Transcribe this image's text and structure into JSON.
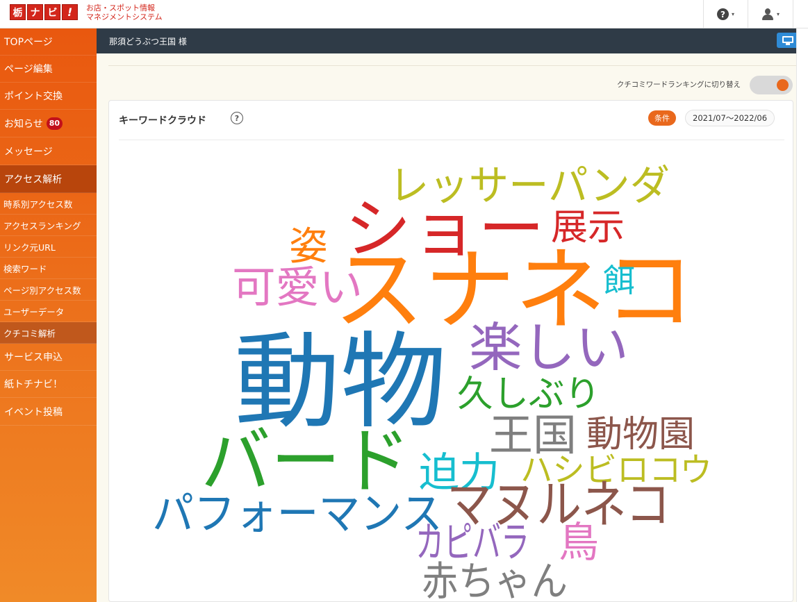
{
  "header": {
    "logo_chars": [
      "栃",
      "ナ",
      "ビ",
      "!"
    ],
    "logo_line1": "お店・スポット情報",
    "logo_line2": "マネジメントシステム",
    "help_caret": "▾",
    "user_caret": "▾"
  },
  "sidebar": {
    "items": [
      {
        "label": "TOPページ"
      },
      {
        "label": "ページ編集"
      },
      {
        "label": "ポイント交換"
      },
      {
        "label": "お知らせ",
        "badge": "80"
      },
      {
        "label": "メッセージ"
      },
      {
        "label": "アクセス解析"
      }
    ],
    "sub_items": [
      {
        "label": "時系別アクセス数"
      },
      {
        "label": "アクセスランキング"
      },
      {
        "label": "リンク元URL"
      },
      {
        "label": "検索ワード"
      },
      {
        "label": "ページ別アクセス数"
      },
      {
        "label": "ユーザーデータ"
      },
      {
        "label": "クチコミ解析"
      }
    ],
    "bottom_items": [
      {
        "label": "サービス申込"
      },
      {
        "label": "紙トチナビ！"
      },
      {
        "label": "イベント投稿"
      }
    ]
  },
  "subbar": {
    "account": "那須どうぶつ王国 様"
  },
  "toggle": {
    "label": "クチコミワードランキングに切り替え"
  },
  "card": {
    "title": "キーワードクラウド",
    "help": "?",
    "condition_label": "条件",
    "period": "2021/07〜2022/06"
  },
  "chart_data": {
    "type": "wordcloud",
    "words": [
      {
        "text": "レッサーパンダ",
        "color": "#bcbd22"
      },
      {
        "text": "ショー",
        "color": "#d62728"
      },
      {
        "text": "展示",
        "color": "#d62728"
      },
      {
        "text": "姿",
        "color": "#ff7f0e"
      },
      {
        "text": "可愛い",
        "color": "#e377c2"
      },
      {
        "text": "スナネコ",
        "color": "#ff7f0e"
      },
      {
        "text": "餌",
        "color": "#17becf"
      },
      {
        "text": "楽しい",
        "color": "#9467bd"
      },
      {
        "text": "動物",
        "color": "#1f77b4"
      },
      {
        "text": "久しぶり",
        "color": "#2ca02c"
      },
      {
        "text": "王国",
        "color": "#7f7f7f"
      },
      {
        "text": "動物園",
        "color": "#8c564b"
      },
      {
        "text": "バード",
        "color": "#2ca02c"
      },
      {
        "text": "迫力",
        "color": "#17becf"
      },
      {
        "text": "ハシビロコウ",
        "color": "#bcbd22"
      },
      {
        "text": "パフォーマンス",
        "color": "#1f77b4"
      },
      {
        "text": "マヌルネコ",
        "color": "#8c564b"
      },
      {
        "text": "カピバラ",
        "color": "#9467bd"
      },
      {
        "text": "鳥",
        "color": "#e377c2"
      },
      {
        "text": "赤ちゃん",
        "color": "#7f7f7f"
      }
    ]
  }
}
